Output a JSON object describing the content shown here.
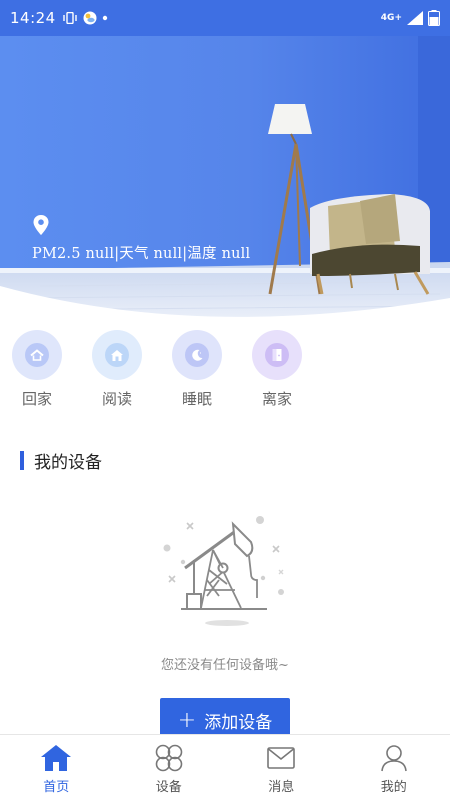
{
  "status_bar": {
    "time": "14:24",
    "network": "4G+",
    "bg_color": "#3e6fe3"
  },
  "hero": {
    "weather_text": "PM2.5 null|天气 null|温度 null",
    "location_icon": "location-pin-icon"
  },
  "scenes": [
    {
      "label": "回家",
      "icon": "home-icon",
      "color": "#dfe6fb",
      "inner": "#b9c8f7"
    },
    {
      "label": "阅读",
      "icon": "book-house-icon",
      "color": "#e0ecfc",
      "inner": "#bcd6f8"
    },
    {
      "label": "睡眠",
      "icon": "moon-icon",
      "color": "#dfe4fb",
      "inner": "#bdc6f6"
    },
    {
      "label": "离家",
      "icon": "door-icon",
      "color": "#e7e0fb",
      "inner": "#cdbdf5"
    }
  ],
  "devices": {
    "title": "我的设备",
    "empty_text": "您还没有任何设备哦~",
    "add_label": "添加设备",
    "accent": "#3065e0"
  },
  "tabs": [
    {
      "label": "首页",
      "icon": "home-tab-icon",
      "active": true
    },
    {
      "label": "设备",
      "icon": "devices-tab-icon",
      "active": false
    },
    {
      "label": "消息",
      "icon": "message-tab-icon",
      "active": false
    },
    {
      "label": "我的",
      "icon": "profile-tab-icon",
      "active": false
    }
  ]
}
